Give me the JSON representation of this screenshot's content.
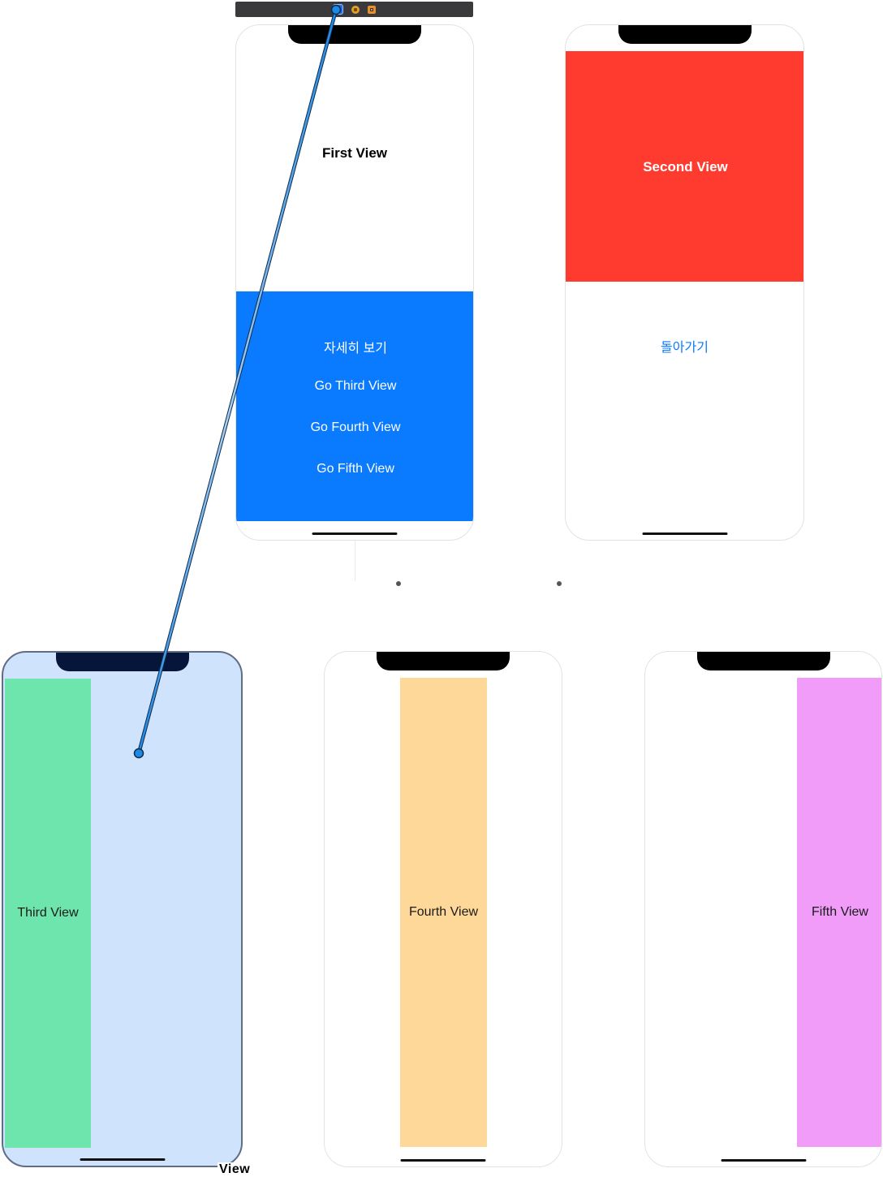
{
  "dock": {
    "icons": [
      "view-controller-icon",
      "first-responder-icon",
      "exit-icon"
    ]
  },
  "first_view": {
    "title": "First View",
    "buttons": [
      "자세히 보기",
      "Go Third View",
      "Go Fourth View",
      "Go Fifth View"
    ],
    "top_color": "#ffffff",
    "bottom_color": "#0a7aff"
  },
  "second_view": {
    "title": "Second View",
    "back_button": "돌아가기",
    "top_color": "#ff3b30"
  },
  "third_view": {
    "label": "Third View",
    "panel_color": "#6ee5ac",
    "selected": true
  },
  "fourth_view": {
    "label": "Fourth View",
    "panel_color": "#fdd898"
  },
  "fifth_view": {
    "label": "Fifth View",
    "panel_color": "#f19cf9"
  },
  "selection": {
    "caption": "View"
  },
  "colors": {
    "connection_line": "#1e88e5",
    "selection_bg": "#cfe3fc"
  }
}
